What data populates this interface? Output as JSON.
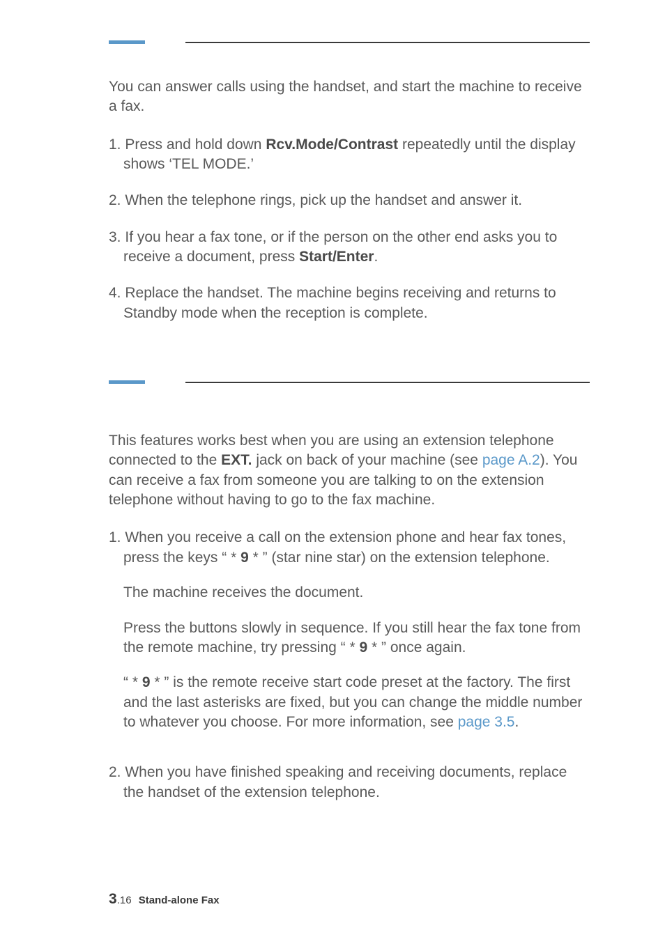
{
  "s1": {
    "intro": "You can answer calls using the handset, and start the machine to receive a fax.",
    "items": [
      {
        "n": "1. ",
        "a": "Press and hold down ",
        "b": "Rcv.Mode/Contrast",
        "c": " repeatedly until the display shows ‘TEL MODE.’"
      },
      {
        "n": "2. ",
        "a": "When the telephone rings, pick up the handset and answer it."
      },
      {
        "n": "3. ",
        "a": "If you hear a fax tone, or if the person on the other end asks you to receive a document, press ",
        "b": "Start/Enter",
        "c": "."
      },
      {
        "n": "4. ",
        "a": "Replace the handset. The machine begins receiving and returns to Standby mode when the reception is complete."
      }
    ]
  },
  "s2": {
    "intro": {
      "a": "This features works best when you are using an extension telephone connected to the ",
      "b": "EXT.",
      "c": " jack on back of your machine (see ",
      "link": "page A.2",
      "d": "). You can receive a fax from someone you are talking to on the extension telephone without having to go to the fax machine."
    },
    "item1": {
      "n": "1. ",
      "a": "When you receive a call on the extension phone and hear fax tones, press the keys “ ",
      "code1a": "*",
      "code1b": " 9 ",
      "code1c": "*",
      "b": " ” (star nine star) on the extension telephone.",
      "p2": "The machine receives the document.",
      "p3a": "Press the buttons slowly in sequence. If you still hear the fax tone from the remote machine, try pressing “ ",
      "p3code1": "*",
      "p3code2": " 9 ",
      "p3code3": "*",
      "p3b": "  ” once again.",
      "p4a": "“ ",
      "p4code1": "*",
      "p4code2": " 9 ",
      "p4code3": "*",
      "p4b": " ” is the remote receive start code preset at the factory. The first and the last asterisks are fixed, but you can change the middle number to whatever you choose. For more information, see ",
      "p4link": "page 3.5",
      "p4c": "."
    },
    "item2": {
      "n": "2. ",
      "a": "When you have finished speaking and receiving documents, replace the handset of the extension telephone."
    }
  },
  "footer": {
    "major": "3",
    "minor": ".16",
    "label": "Stand-alone Fax"
  }
}
